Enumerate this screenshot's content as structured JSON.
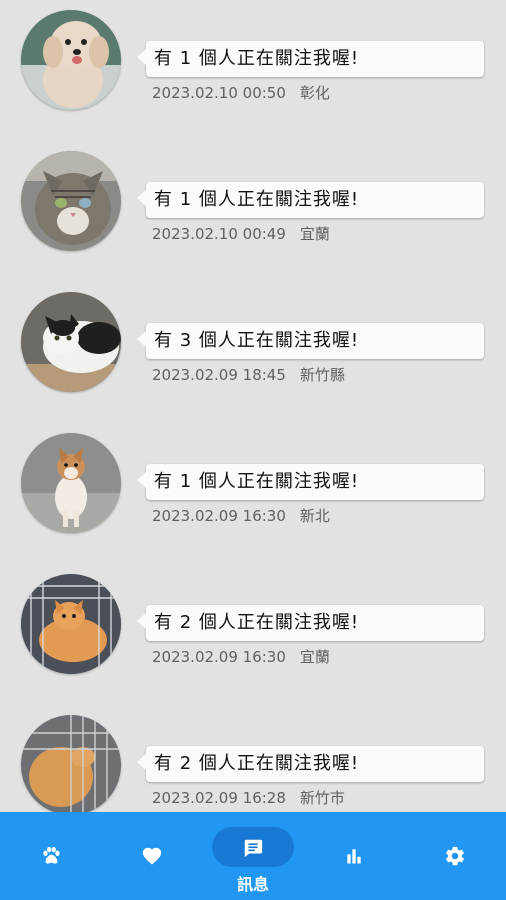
{
  "notifications": [
    {
      "message": "有 1 個人正在關注我喔!",
      "timestamp": "2023.02.10 00:50",
      "location": "彰化"
    },
    {
      "message": "有 1 個人正在關注我喔!",
      "timestamp": "2023.02.10 00:49",
      "location": "宜蘭"
    },
    {
      "message": "有 3 個人正在關注我喔!",
      "timestamp": "2023.02.09 18:45",
      "location": "新竹縣"
    },
    {
      "message": "有 1 個人正在關注我喔!",
      "timestamp": "2023.02.09 16:30",
      "location": "新北"
    },
    {
      "message": "有 2 個人正在關注我喔!",
      "timestamp": "2023.02.09 16:30",
      "location": "宜蘭"
    },
    {
      "message": "有 2 個人正在關注我喔!",
      "timestamp": "2023.02.09 16:28",
      "location": "新竹市"
    }
  ],
  "bottom_nav": {
    "items": [
      {
        "icon": "paw-icon"
      },
      {
        "icon": "heart-icon"
      },
      {
        "icon": "message-icon",
        "label": "訊息",
        "active": true
      },
      {
        "icon": "bar-chart-icon"
      },
      {
        "icon": "gear-icon"
      }
    ]
  },
  "colors": {
    "background": "#e2e2e2",
    "nav_bar": "#2196f3",
    "nav_active_pill": "#1779d3",
    "bubble": "#fbfbfb",
    "meta_text": "#616161"
  }
}
